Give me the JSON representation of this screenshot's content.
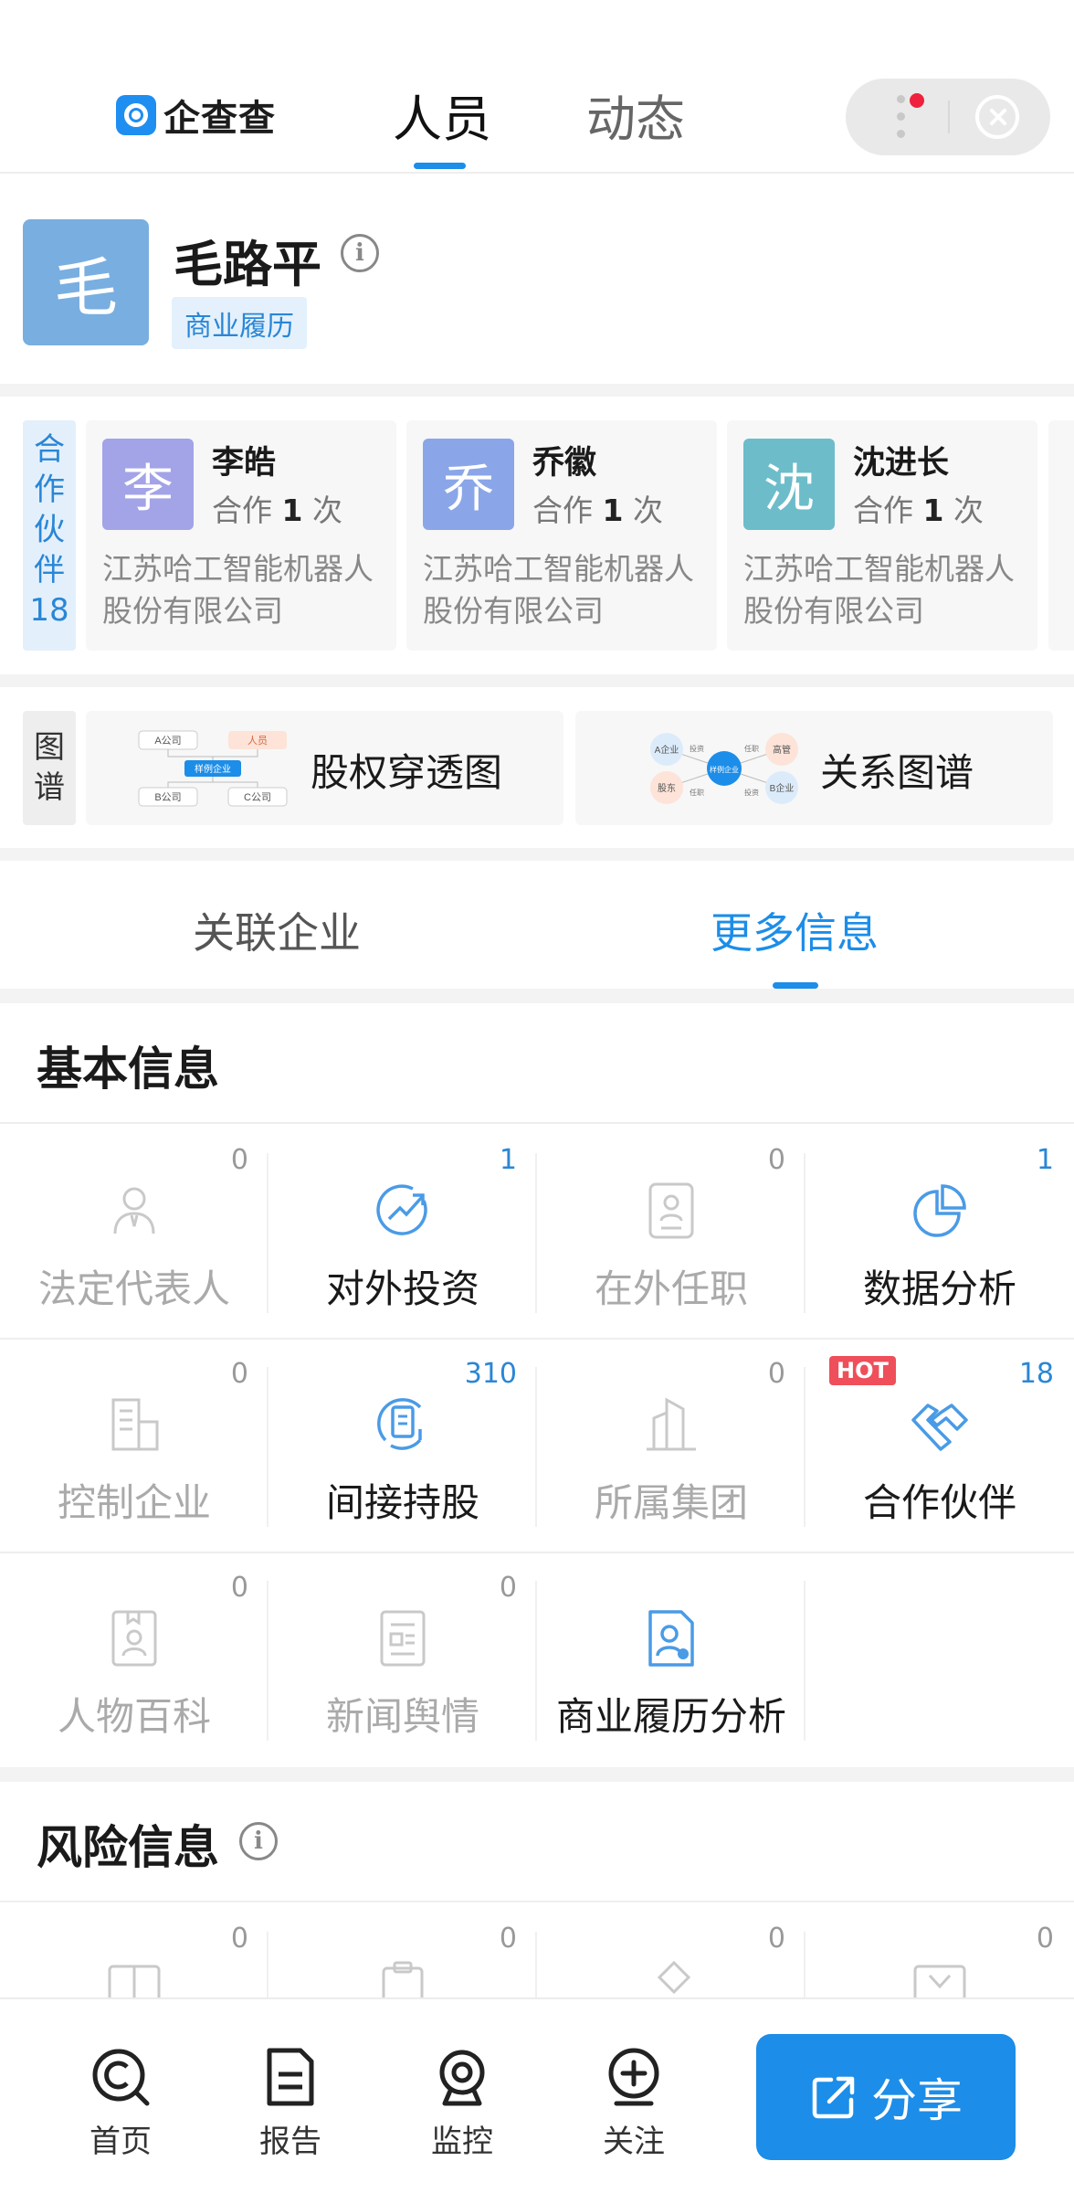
{
  "header": {
    "logo_text": "企查查",
    "tab_people": "人员",
    "tab_dynamics": "动态"
  },
  "profile": {
    "avatar_char": "毛",
    "name": "毛路平",
    "tag": "商业履历"
  },
  "partners": {
    "label_chars": [
      "合",
      "作",
      "伙",
      "伴"
    ],
    "label_count": "18",
    "cards": [
      {
        "avatar": "李",
        "name": "李皓",
        "coop_prefix": "合作",
        "coop_count": "1",
        "coop_suffix": "次",
        "company_line1": "江苏哈工智能机器人",
        "company_line2": "股份有限公司",
        "color": "#a3a3e8"
      },
      {
        "avatar": "乔",
        "name": "乔徽",
        "coop_prefix": "合作",
        "coop_count": "1",
        "coop_suffix": "次",
        "company_line1": "江苏哈工智能机器人",
        "company_line2": "股份有限公司",
        "color": "#8aa6e8"
      },
      {
        "avatar": "沈",
        "name": "沈进长",
        "coop_prefix": "合作",
        "coop_count": "1",
        "coop_suffix": "次",
        "company_line1": "江苏哈工智能机器人",
        "company_line2": "股份有限公司",
        "color": "#6dbcca"
      }
    ]
  },
  "graphs": {
    "label_chars": [
      "图",
      "谱"
    ],
    "equity": {
      "label": "股权穿透图",
      "node_a": "A公司",
      "node_person": "人员",
      "node_center": "样例企业",
      "node_b": "B公司",
      "node_c": "C公司"
    },
    "relation": {
      "label": "关系图谱",
      "node_a": "A企业",
      "node_exec": "高管",
      "node_center": "样例企业",
      "node_holder": "股东",
      "node_b": "B企业",
      "edge_invest": "投资",
      "edge_post": "任职"
    }
  },
  "section_tabs": {
    "related": "关联企业",
    "more": "更多信息"
  },
  "basic": {
    "title": "基本信息",
    "cells": [
      {
        "label": "法定代表人",
        "count": "0",
        "icon": "legal-rep-icon",
        "active": false
      },
      {
        "label": "对外投资",
        "count": "1",
        "icon": "investment-icon",
        "active": true
      },
      {
        "label": "在外任职",
        "count": "0",
        "icon": "position-icon",
        "active": false
      },
      {
        "label": "数据分析",
        "count": "1",
        "icon": "pie-chart-icon",
        "active": true
      },
      {
        "label": "控制企业",
        "count": "0",
        "icon": "building-icon",
        "active": false
      },
      {
        "label": "间接持股",
        "count": "310",
        "icon": "holding-icon",
        "active": true
      },
      {
        "label": "所属集团",
        "count": "0",
        "icon": "group-icon",
        "active": false
      },
      {
        "label": "合作伙伴",
        "count": "18",
        "icon": "handshake-icon",
        "active": true,
        "badge": "HOT"
      },
      {
        "label": "人物百科",
        "count": "0",
        "icon": "wiki-icon",
        "active": false
      },
      {
        "label": "新闻舆情",
        "count": "0",
        "icon": "news-icon",
        "active": false
      },
      {
        "label": "商业履历分析",
        "count": "",
        "icon": "resume-icon",
        "active": true
      }
    ]
  },
  "risk": {
    "title": "风险信息",
    "counts": [
      "0",
      "0",
      "0",
      "0"
    ]
  },
  "bottom_nav": {
    "home": "首页",
    "report": "报告",
    "monitor": "监控",
    "follow": "关注",
    "share": "分享"
  },
  "colors": {
    "accent": "#1c8de8",
    "tag_bg": "#e4f1fc",
    "hot": "#ef4f5a"
  }
}
